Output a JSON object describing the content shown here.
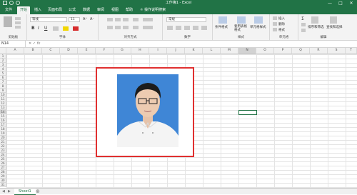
{
  "window": {
    "title": "工作簿1 - Excel",
    "controls": [
      "—",
      "□",
      "✕"
    ]
  },
  "ribbon_tabs": [
    "文件",
    "开始",
    "插入",
    "页面布局",
    "公式",
    "数据",
    "审阅",
    "视图",
    "帮助"
  ],
  "active_tab": "开始",
  "tell_me": "操作说明搜索",
  "ribbon": {
    "clipboard": {
      "label": "剪贴板"
    },
    "font": {
      "name": "等线",
      "size": "11",
      "label": "字体",
      "buttons": [
        "B",
        "I",
        "U"
      ]
    },
    "alignment": {
      "label": "对齐方式"
    },
    "number": {
      "format": "常规",
      "label": "数字"
    },
    "styles": {
      "label": "样式",
      "items": [
        "条件格式",
        "套用表格格式",
        "单元格样式"
      ]
    },
    "cells": {
      "label": "单元格",
      "items": [
        "插入",
        "删除",
        "格式"
      ]
    },
    "editing": {
      "label": "编辑",
      "items": [
        "排序和筛选",
        "查找和选择"
      ]
    }
  },
  "formula_bar": {
    "name_box": "N14",
    "fx": "fx",
    "value": ""
  },
  "columns": [
    "A",
    "B",
    "C",
    "D",
    "E",
    "F",
    "G",
    "H",
    "I",
    "J",
    "K",
    "L",
    "M",
    "N",
    "O",
    "P",
    "Q",
    "R",
    "S",
    "T"
  ],
  "rows": [
    "1",
    "2",
    "3",
    "4",
    "5",
    "6",
    "7",
    "8",
    "9",
    "10",
    "11",
    "12",
    "13",
    "14",
    "15",
    "16",
    "17",
    "18",
    "19",
    "20",
    "21",
    "22",
    "23",
    "24",
    "25",
    "26",
    "27",
    "28",
    "29",
    "30",
    "31"
  ],
  "selected_cell": "N14",
  "sheet_tabs": [
    "Sheet1"
  ],
  "colors": {
    "excel_green": "#217346",
    "highlight_red": "#e03030",
    "photo_bg": "#3f86d6"
  }
}
